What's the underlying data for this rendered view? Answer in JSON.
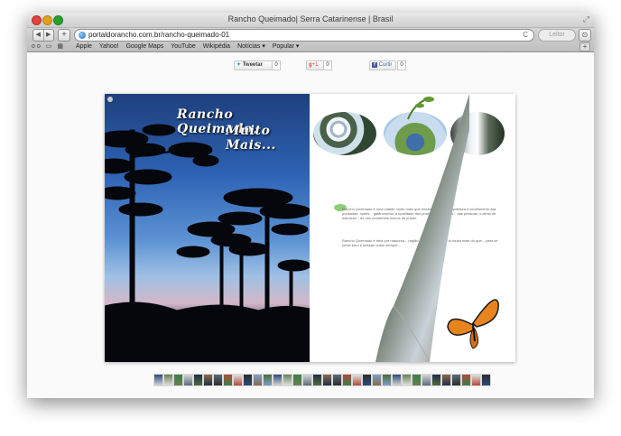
{
  "window": {
    "title": "Rancho Queimado| Serra Catarinense | Brasil"
  },
  "toolbar": {
    "back_icon": "back-arrow-icon",
    "forward_icon": "forward-arrow-icon",
    "add_label": "+",
    "url": "portaldorancho.com.br/rancho-queimado-01",
    "reload_label": "C",
    "reader_label": "Leitor",
    "downloads_label": "⊙"
  },
  "bookmarks": {
    "icons": [
      "reading-list-icon",
      "bookmarks-book-icon",
      "top-sites-grid-icon"
    ],
    "items": [
      "Apple",
      "Yahoo!",
      "Google Maps",
      "YouTube",
      "Wikipédia",
      "Notícias ▾",
      "Popular ▾"
    ]
  },
  "social": {
    "tweet_label": "Tweetar",
    "tweet_count": "0",
    "gplus_label": "+1",
    "gplus_count": "0",
    "fb_label": "Curtir",
    "fb_count": "0"
  },
  "book": {
    "title_line1": "Rancho Queimado,",
    "title_line2": "Muito Mais...",
    "body_paragraph1": "Rancho Queimado é uma cidade muito mais que encantadora... a arquitetura e acolhimento das pousadas, hotéis... gastronomia, a qualidade dos produtos e serviços... das pessoas, o clima de natureza... de uns momentos únicos de prazer.",
    "body_paragraph2": "Rancho Queimado é bela por natureza... região e aqueles a torne tu muito mais do que... para se sentir bem e desejar voltar sempre..."
  },
  "colors": {
    "sky_top": "#1f3f7d",
    "horizon": "#d3b8c9",
    "butterfly": "#e8841e"
  },
  "thumbnails_count": 34
}
